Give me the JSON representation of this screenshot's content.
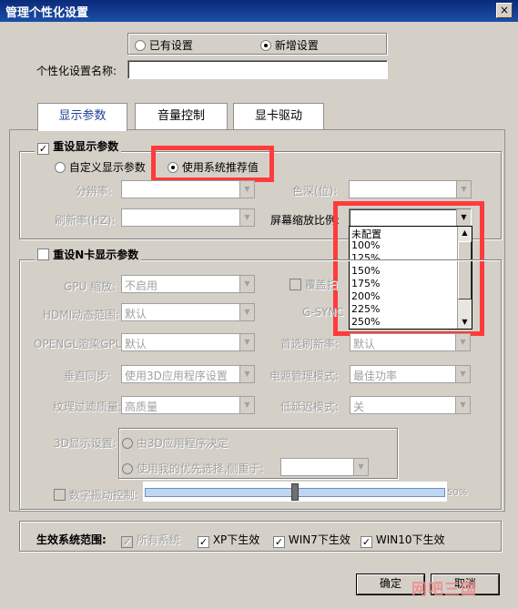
{
  "window": {
    "title": "管理个性化设置",
    "close_glyph": "×"
  },
  "mode": {
    "existing": "已有设置",
    "new": "新增设置"
  },
  "name_label": "个性化设置名称:",
  "name_value": "",
  "tabs": [
    "显示参数",
    "音量控制",
    "显卡驱动"
  ],
  "display": {
    "reset_label": "重设显示参数",
    "custom_label": "自定义显示参数",
    "recommended_label": "使用系统推荐值",
    "resolution": "分辨率:",
    "color_depth": "色深(位):",
    "refresh": "刷新率(HZ):",
    "scale": "屏幕缩放比例:",
    "scale_options": [
      "未配置",
      "100%",
      "125%",
      "150%",
      "175%",
      "200%",
      "225%",
      "250%"
    ]
  },
  "nvidia": {
    "reset_label": "重设N卡显示参数",
    "gpu_scale": "GPU 缩放:",
    "gpu_scale_value": "不启用",
    "overlay": "覆盖扫",
    "hdmi": "HDMI动态范围:",
    "hdmi_value": "默认",
    "gsync": "G-SYNC",
    "opengl": "OPENGL渲染GPU:",
    "opengl_value": "默认",
    "pref_refresh": "首选刷新率:",
    "pref_refresh_value": "默认",
    "vsync": "垂直同步:",
    "vsync_value": "使用3D应用程序设置",
    "power": "电源管理模式:",
    "power_value": "最佳功率",
    "filter": "纹理过滤质量:",
    "filter_value": "高质量",
    "latency": "低延迟模式:",
    "latency_value": "关",
    "display3d": "3D显示设置:",
    "by_app": "由3D应用程序决定",
    "my_pref": "使用我的优先选择,侧重于:",
    "vibrance": "数字振动控制:",
    "vibrance_pct": "50%",
    "vibrance_level": 0.5
  },
  "scope": {
    "label": "生效系统范围:",
    "all": "所有系统",
    "xp": "XP下生效",
    "win7": "WIN7下生效",
    "win10": "WIN10下生效"
  },
  "buttons": {
    "ok": "确定",
    "cancel": "取消"
  },
  "watermark": "网吧三国"
}
